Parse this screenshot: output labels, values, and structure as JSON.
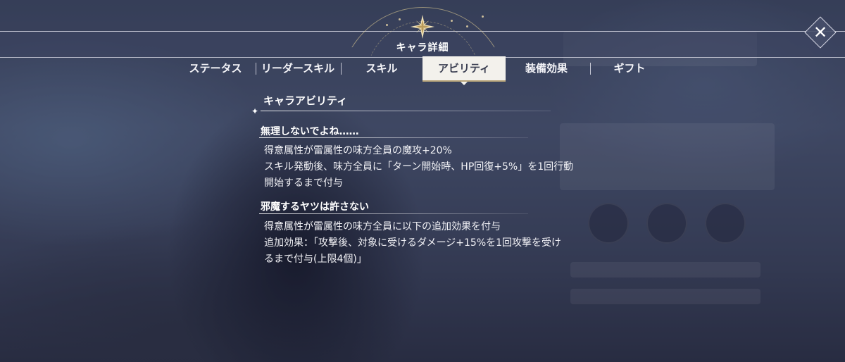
{
  "header": {
    "title": "キャラ詳細",
    "close_label": "✕"
  },
  "tabs": [
    {
      "label": "ステータス"
    },
    {
      "label": "リーダースキル"
    },
    {
      "label": "スキル"
    },
    {
      "label": "アビリティ",
      "active": true
    },
    {
      "label": "装備効果"
    },
    {
      "label": "ギフト"
    }
  ],
  "section": {
    "title": "キャラアビリティ"
  },
  "abilities": [
    {
      "name": "無理しないでよね……",
      "lines": [
        "得意属性が雷属性の味方全員の魔攻+20%",
        "スキル発動後、味方全員に「ターン開始時、HP回復+5%」を1回行動",
        "開始するまで付与"
      ]
    },
    {
      "name": "邪魔するヤツは許さない",
      "lines": [
        "得意属性が雷属性の味方全員に以下の追加効果を付与",
        "追加効果：「攻撃後、対象に受けるダメージ+15%を1回攻撃を受け",
        "るまで付与(上限4個)」"
      ]
    }
  ],
  "colors": {
    "active_tab_bg": "#f3f1ec",
    "active_tab_text": "#3b3f52",
    "accent_gold": "#b9a57a"
  }
}
